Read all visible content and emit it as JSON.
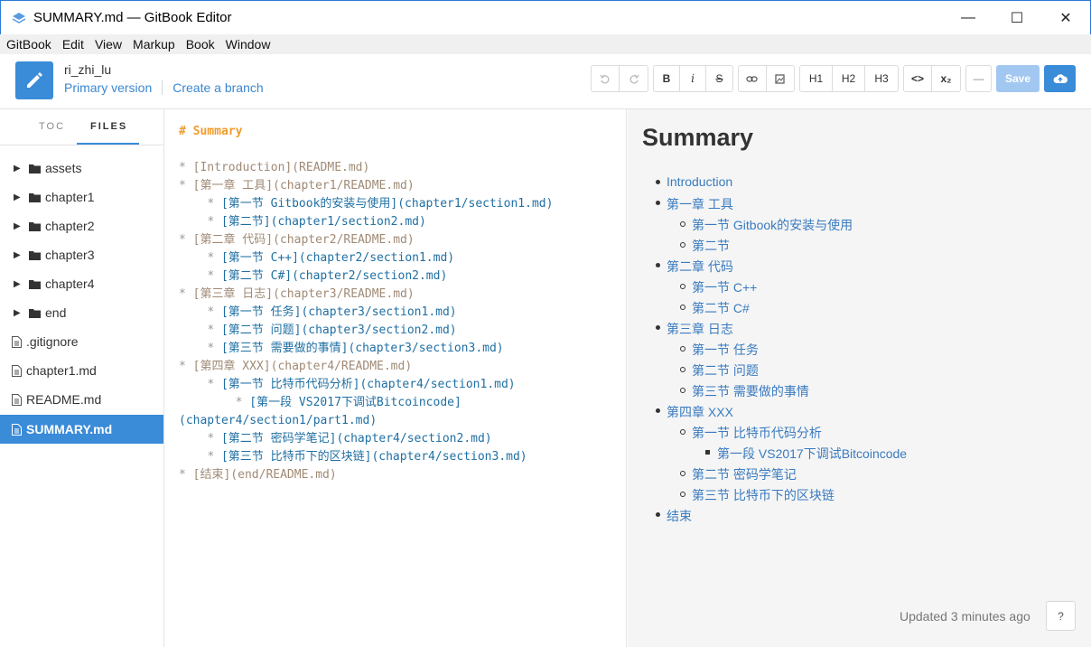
{
  "window": {
    "title": "SUMMARY.md — GitBook Editor",
    "controls": {
      "minimize": "—",
      "maximize": "☐",
      "close": "✕"
    }
  },
  "menu": [
    "GitBook",
    "Edit",
    "View",
    "Markup",
    "Book",
    "Window"
  ],
  "header": {
    "book_name": "ri_zhi_lu",
    "primary_version": "Primary version",
    "create_branch": "Create a branch"
  },
  "toolbar": {
    "undo_icon": "undo-icon",
    "redo_icon": "redo-icon",
    "bold": "B",
    "italic": "i",
    "strike": "S",
    "link_icon": "link-icon",
    "image_icon": "image-icon",
    "h1": "H1",
    "h2": "H2",
    "h3": "H3",
    "code": "<>",
    "subscript": "x₂",
    "hr": "—",
    "save": "Save",
    "sync_icon": "cloud-upload-icon"
  },
  "sidebar": {
    "tabs": {
      "toc": "TOC",
      "files": "FILES"
    },
    "files": [
      {
        "name": "assets",
        "type": "folder"
      },
      {
        "name": "chapter1",
        "type": "folder"
      },
      {
        "name": "chapter2",
        "type": "folder"
      },
      {
        "name": "chapter3",
        "type": "folder"
      },
      {
        "name": "chapter4",
        "type": "folder"
      },
      {
        "name": "end",
        "type": "folder"
      },
      {
        "name": ".gitignore",
        "type": "file"
      },
      {
        "name": "chapter1.md",
        "type": "file"
      },
      {
        "name": "README.md",
        "type": "file"
      },
      {
        "name": "SUMMARY.md",
        "type": "file",
        "active": true
      }
    ]
  },
  "editor": {
    "heading": "# Summary",
    "lines": [
      {
        "indent": "",
        "bullet": "* ",
        "link": "[Introduction](README.md)",
        "level": 1
      },
      {
        "indent": "",
        "bullet": "* ",
        "link": "[第一章 工具](chapter1/README.md)",
        "level": 1
      },
      {
        "indent": "    ",
        "bullet": "* ",
        "link": "[第一节 Gitbook的安装与使用](chapter1/section1.md)",
        "level": 2
      },
      {
        "indent": "    ",
        "bullet": "* ",
        "link": "[第二节](chapter1/section2.md)",
        "level": 2
      },
      {
        "indent": "",
        "bullet": "* ",
        "link": "[第二章 代码](chapter2/README.md)",
        "level": 1
      },
      {
        "indent": "    ",
        "bullet": "* ",
        "link": "[第一节 C++](chapter2/section1.md)",
        "level": 2
      },
      {
        "indent": "    ",
        "bullet": "* ",
        "link": "[第二节 C#](chapter2/section2.md)",
        "level": 2
      },
      {
        "indent": "",
        "bullet": "* ",
        "link": "[第三章 日志](chapter3/README.md)",
        "level": 1
      },
      {
        "indent": "    ",
        "bullet": "* ",
        "link": "[第一节 任务](chapter3/section1.md)",
        "level": 2
      },
      {
        "indent": "    ",
        "bullet": "* ",
        "link": "[第二节 问题](chapter3/section2.md)",
        "level": 2
      },
      {
        "indent": "    ",
        "bullet": "* ",
        "link": "[第三节 需要做的事情](chapter3/section3.md)",
        "level": 2
      },
      {
        "indent": "",
        "bullet": "* ",
        "link": "[第四章 XXX](chapter4/README.md)",
        "level": 1
      },
      {
        "indent": "    ",
        "bullet": "* ",
        "link": "[第一节 比特币代码分析](chapter4/section1.md)",
        "level": 2
      },
      {
        "indent": "        ",
        "bullet": "* ",
        "link": "[第一段 VS2017下调试Bitcoincode]",
        "level": 2
      },
      {
        "indent": "",
        "bullet": "",
        "link": "(chapter4/section1/part1.md)",
        "level": 2
      },
      {
        "indent": "    ",
        "bullet": "* ",
        "link": "[第二节 密码学笔记](chapter4/section2.md)",
        "level": 2
      },
      {
        "indent": "    ",
        "bullet": "* ",
        "link": "[第三节 比特币下的区块链](chapter4/section3.md)",
        "level": 2
      },
      {
        "indent": "",
        "bullet": "* ",
        "link": "[结束](end/README.md)",
        "level": 1
      }
    ]
  },
  "preview": {
    "title": "Summary",
    "items": [
      {
        "text": "Introduction",
        "depth": 0
      },
      {
        "text": "第一章 工具",
        "depth": 0
      },
      {
        "text": "第一节 Gitbook的安装与使用",
        "depth": 1
      },
      {
        "text": "第二节",
        "depth": 1
      },
      {
        "text": "第二章 代码",
        "depth": 0
      },
      {
        "text": "第一节 C++",
        "depth": 1
      },
      {
        "text": "第二节 C#",
        "depth": 1
      },
      {
        "text": "第三章 日志",
        "depth": 0
      },
      {
        "text": "第一节 任务",
        "depth": 1
      },
      {
        "text": "第二节 问题",
        "depth": 1
      },
      {
        "text": "第三节 需要做的事情",
        "depth": 1
      },
      {
        "text": "第四章 XXX",
        "depth": 0
      },
      {
        "text": "第一节 比特币代码分析",
        "depth": 1
      },
      {
        "text": "第一段 VS2017下调试Bitcoincode",
        "depth": 2
      },
      {
        "text": "第二节 密码学笔记",
        "depth": 1
      },
      {
        "text": "第三节 比特币下的区块链",
        "depth": 1
      },
      {
        "text": "结束",
        "depth": 0
      }
    ],
    "updated": "Updated 3 minutes ago",
    "help": "?"
  }
}
